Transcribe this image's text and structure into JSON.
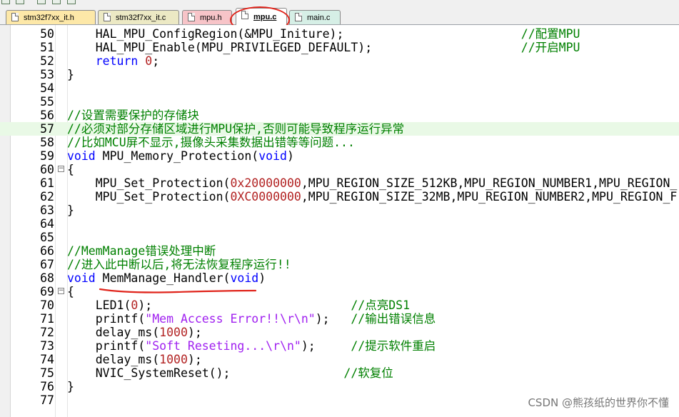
{
  "tabs": [
    {
      "label": "stm32f7xx_it.h",
      "bg": "#fde8a8",
      "active": false
    },
    {
      "label": "stm32f7xx_it.c",
      "bg": "#ece9c4",
      "active": false
    },
    {
      "label": "mpu.h",
      "bg": "#f7c4c8",
      "active": false
    },
    {
      "label": "mpu.c",
      "bg": "#ffffff",
      "active": true
    },
    {
      "label": "main.c",
      "bg": "#d6efe6",
      "active": false
    }
  ],
  "colors": {
    "keyword": "#0000ff",
    "number": "#b22222",
    "string": "#a020f0",
    "comment": "#008000",
    "highlight_line": "#e9f9e6",
    "annotation": "#e0241b"
  },
  "lines": [
    {
      "n": "50",
      "fold": "",
      "hl": false,
      "segs": [
        [
          "",
          "    HAL_MPU_ConfigRegion(&MPU_Initure);                         "
        ],
        [
          "cm",
          "//配置MPU"
        ]
      ]
    },
    {
      "n": "51",
      "fold": "",
      "hl": false,
      "segs": [
        [
          "",
          "    HAL_MPU_Enable(MPU_PRIVILEGED_DEFAULT);                     "
        ],
        [
          "cm",
          "//开启MPU"
        ]
      ]
    },
    {
      "n": "52",
      "fold": "",
      "hl": false,
      "segs": [
        [
          "",
          "    "
        ],
        [
          "kw",
          "return"
        ],
        [
          "",
          " "
        ],
        [
          "num",
          "0"
        ],
        [
          "",
          ";"
        ]
      ]
    },
    {
      "n": "53",
      "fold": "",
      "hl": false,
      "segs": [
        [
          "",
          "}"
        ]
      ]
    },
    {
      "n": "54",
      "fold": "",
      "hl": false,
      "segs": []
    },
    {
      "n": "55",
      "fold": "",
      "hl": false,
      "segs": []
    },
    {
      "n": "56",
      "fold": "",
      "hl": false,
      "segs": [
        [
          "cm",
          "//设置需要保护的存储块"
        ]
      ]
    },
    {
      "n": "57",
      "fold": "",
      "hl": true,
      "segs": [
        [
          "cm",
          "//必须对部分存储区域进行MPU保护,否则可能导致程序运行异常"
        ]
      ]
    },
    {
      "n": "58",
      "fold": "",
      "hl": false,
      "segs": [
        [
          "cm",
          "//比如MCU屏不显示,摄像头采集数据出错等等问题..."
        ]
      ]
    },
    {
      "n": "59",
      "fold": "",
      "hl": false,
      "segs": [
        [
          "kw",
          "void"
        ],
        [
          "",
          " MPU_Memory_Protection("
        ],
        [
          "kw",
          "void"
        ],
        [
          "",
          ")"
        ]
      ]
    },
    {
      "n": "60",
      "fold": "−",
      "hl": false,
      "segs": [
        [
          "",
          "{"
        ]
      ]
    },
    {
      "n": "61",
      "fold": "",
      "hl": false,
      "segs": [
        [
          "",
          "    MPU_Set_Protection("
        ],
        [
          "num",
          "0x20000000"
        ],
        [
          "",
          ",MPU_REGION_SIZE_512KB,MPU_REGION_NUMBER1,MPU_REGION_"
        ]
      ]
    },
    {
      "n": "62",
      "fold": "",
      "hl": false,
      "segs": [
        [
          "",
          "    MPU_Set_Protection("
        ],
        [
          "num",
          "0XC0000000"
        ],
        [
          "",
          ",MPU_REGION_SIZE_32MB,MPU_REGION_NUMBER2,MPU_REGION_F"
        ]
      ]
    },
    {
      "n": "63",
      "fold": "",
      "hl": false,
      "segs": [
        [
          "",
          "}"
        ]
      ]
    },
    {
      "n": "64",
      "fold": "",
      "hl": false,
      "segs": []
    },
    {
      "n": "65",
      "fold": "",
      "hl": false,
      "segs": []
    },
    {
      "n": "66",
      "fold": "",
      "hl": false,
      "segs": [
        [
          "cm",
          "//MemManage错误处理中断"
        ]
      ]
    },
    {
      "n": "67",
      "fold": "",
      "hl": false,
      "segs": [
        [
          "cm",
          "//进入此中断以后,将无法恢复程序运行!!"
        ]
      ]
    },
    {
      "n": "68",
      "fold": "",
      "hl": false,
      "segs": [
        [
          "kw",
          "void"
        ],
        [
          "",
          " MemManage_Handler("
        ],
        [
          "kw",
          "void"
        ],
        [
          "",
          ")"
        ]
      ]
    },
    {
      "n": "69",
      "fold": "−",
      "hl": false,
      "segs": [
        [
          "",
          "{"
        ]
      ]
    },
    {
      "n": "70",
      "fold": "",
      "hl": false,
      "segs": [
        [
          "",
          "    LED1("
        ],
        [
          "num",
          "0"
        ],
        [
          "",
          ");                            "
        ],
        [
          "cm",
          "//点亮DS1"
        ]
      ]
    },
    {
      "n": "71",
      "fold": "",
      "hl": false,
      "segs": [
        [
          "",
          "    printf("
        ],
        [
          "str",
          "\"Mem Access Error!!\\r\\n\""
        ],
        [
          "",
          ");   "
        ],
        [
          "cm",
          "//输出错误信息"
        ]
      ]
    },
    {
      "n": "72",
      "fold": "",
      "hl": false,
      "segs": [
        [
          "",
          "    delay_ms("
        ],
        [
          "num",
          "1000"
        ],
        [
          "",
          ");"
        ]
      ]
    },
    {
      "n": "73",
      "fold": "",
      "hl": false,
      "segs": [
        [
          "",
          "    printf("
        ],
        [
          "str",
          "\"Soft Reseting...\\r\\n\""
        ],
        [
          "",
          ");     "
        ],
        [
          "cm",
          "//提示软件重启"
        ]
      ]
    },
    {
      "n": "74",
      "fold": "",
      "hl": false,
      "segs": [
        [
          "",
          "    delay_ms("
        ],
        [
          "num",
          "1000"
        ],
        [
          "",
          ");"
        ]
      ]
    },
    {
      "n": "75",
      "fold": "",
      "hl": false,
      "segs": [
        [
          "",
          "    NVIC_SystemReset();                "
        ],
        [
          "cm",
          "//软复位"
        ]
      ]
    },
    {
      "n": "76",
      "fold": "",
      "hl": false,
      "segs": [
        [
          "",
          "}"
        ]
      ]
    },
    {
      "n": "77",
      "fold": "",
      "hl": false,
      "segs": []
    }
  ],
  "watermark": "CSDN @熊孩纸的世界你不懂"
}
